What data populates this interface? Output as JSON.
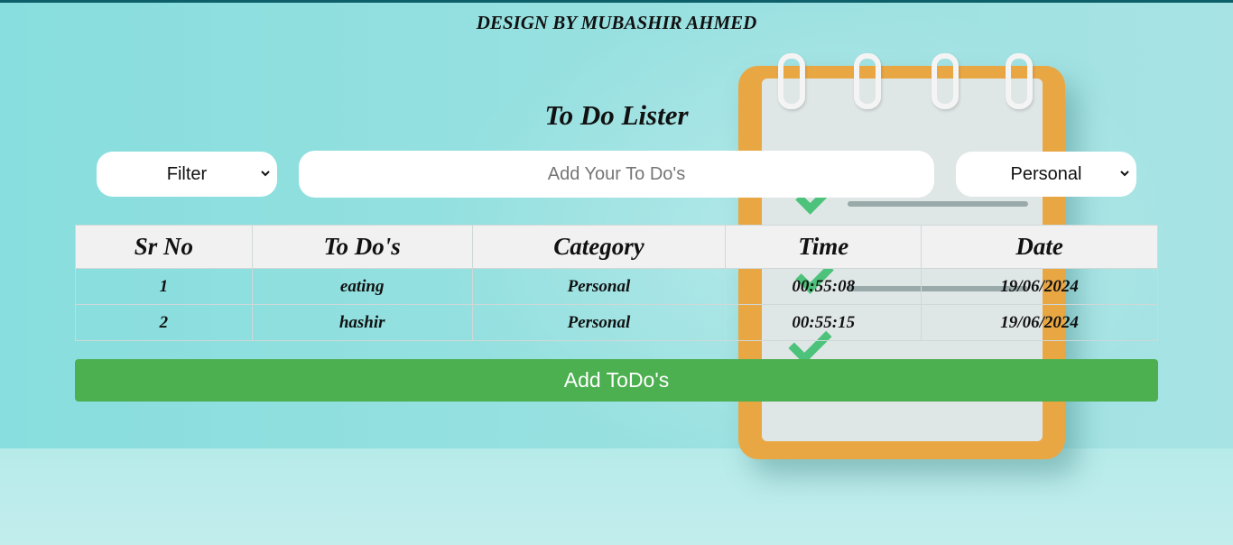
{
  "app": {
    "credit": "DESIGN BY MUBASHIR AHMED",
    "title": "To Do Lister"
  },
  "controls": {
    "filter_selected": "Filter",
    "input_placeholder": "Add Your To Do's",
    "input_value": "",
    "category_selected": "Personal"
  },
  "table": {
    "headers": [
      "Sr No",
      "To Do's",
      "Category",
      "Time",
      "Date"
    ],
    "rows": [
      [
        "1",
        "eating",
        "Personal",
        "00:55:08",
        "19/06/2024"
      ],
      [
        "2",
        "hashir",
        "Personal",
        "00:55:15",
        "19/06/2024"
      ]
    ]
  },
  "actions": {
    "add_label": "Add ToDo's"
  },
  "icons": {
    "select_arrow": "chevron-down-icon"
  },
  "colors": {
    "accent_button": "#4caf50",
    "background": "#8fdcdc",
    "notepad": "#e9a744",
    "check": "#4cc27a"
  }
}
